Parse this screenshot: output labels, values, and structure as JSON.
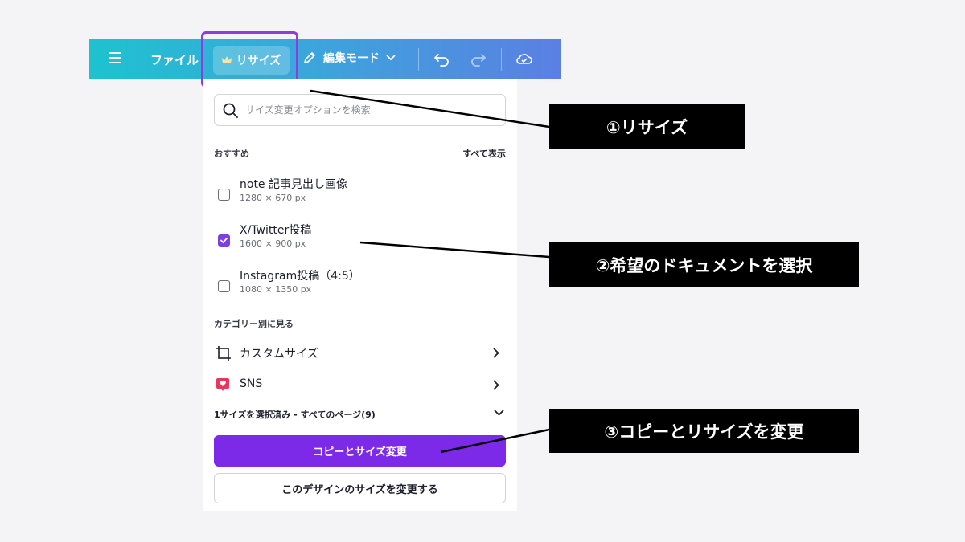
{
  "toolbar": {
    "file_label": "ファイル",
    "resize_label": "リサイズ",
    "edit_mode_label": "編集モード"
  },
  "panel": {
    "search_placeholder": "サイズ変更オプションを検索",
    "recommended_heading": "おすすめ",
    "see_all_label": "すべて表示",
    "options": [
      {
        "title": "note 記事見出し画像",
        "size": "1280 × 670 px",
        "checked": false
      },
      {
        "title": "X/Twitter投稿",
        "size": "1600 × 900 px",
        "checked": true
      },
      {
        "title": "Instagram投稿（4:5）",
        "size": "1080 × 1350 px",
        "checked": false
      }
    ],
    "category_heading": "カテゴリー別に見る",
    "categories": [
      {
        "label": "カスタムサイズ",
        "icon": "custom-size-icon"
      },
      {
        "label": "SNS",
        "icon": "sns-heart-icon"
      }
    ],
    "selection_summary": "1サイズを選択済み - すべてのページ(9)",
    "copy_resize_button": "コピーとサイズ変更",
    "resize_this_button": "このデザインのサイズを変更する"
  },
  "callouts": {
    "step1": "①リサイズ",
    "step2": "②希望のドキュメントを選択",
    "step3": "③コピーとリサイズを変更"
  },
  "colors": {
    "accent": "#7d2ae8",
    "highlight_border": "#8e3de0",
    "toolbar_start": "#1ec2cf",
    "toolbar_end": "#5b7fe3",
    "sns_icon": "#e8365d"
  }
}
